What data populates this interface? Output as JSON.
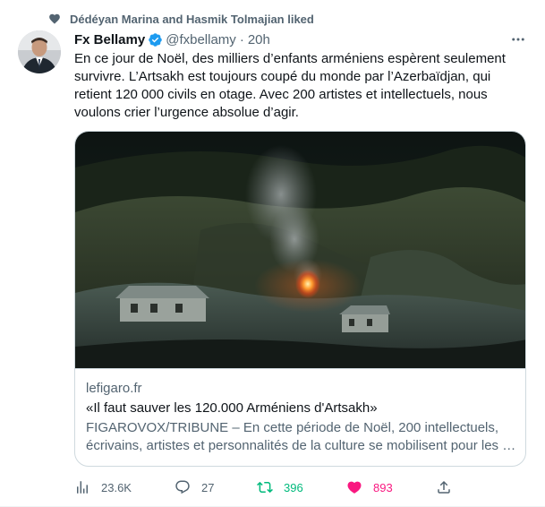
{
  "social_context": {
    "text": "Dédéyan Marina and Hasmik Tolmajian liked",
    "icon": "heart-icon"
  },
  "author": {
    "name": "Fx Bellamy",
    "handle": "@fxbellamy",
    "separator": "·",
    "time": "20h",
    "verified": true
  },
  "tweet": {
    "text": "En ce jour de Noël, des milliers d’enfants arméniens espèrent seulement\nsurvivre. L’Artsakh est toujours coupé du monde par l’Azerbaïdjan, qui\nretient 120 000 civils en otage. Avec 200 artistes et intellectuels, nous\nvoulons crier l’urgence absolue d’agir."
  },
  "card": {
    "domain": "lefigaro.fr",
    "title": "«Il faut sauver les 120.000 Arméniens d'Artsakh»",
    "description": "FIGAROVOX/TRIBUNE – En cette période de Noël, 200 intellectuels,\nécrivains, artistes et personnalités de la culture se mobilisent pour les …"
  },
  "actions": {
    "views": "23.6K",
    "replies": "27",
    "retweets": "396",
    "likes": "893"
  },
  "colors": {
    "verified": "#1d9bf0",
    "retweet": "#00ba7c",
    "like": "#f91880",
    "secondary_text": "#536471"
  }
}
